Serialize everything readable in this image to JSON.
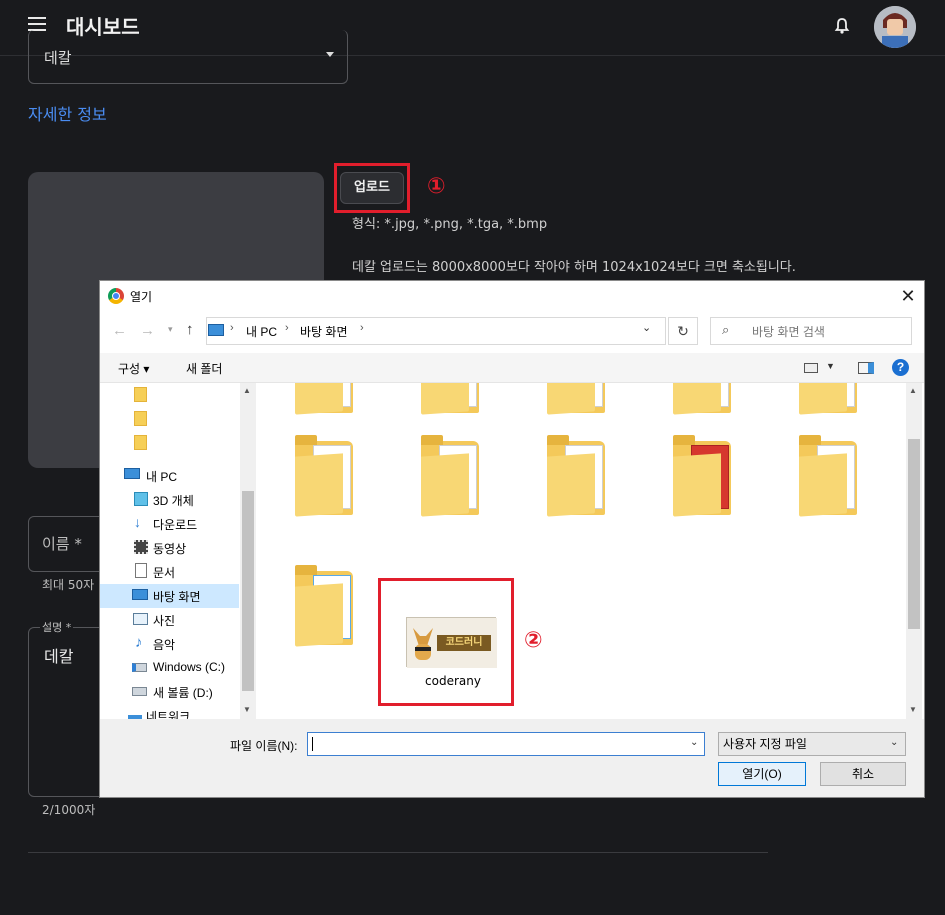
{
  "app": {
    "title": "대시보드"
  },
  "page": {
    "select_value": "데칼",
    "details_link": "자세한 정보",
    "upload_button": "업로드",
    "marker1": "①",
    "formats": "형식: *.jpg, *.png, *.tga, *.bmp",
    "decal_note": "데칼 업로드는 8000x8000보다 작아야 하며 1024x1024보다 크면 축소됩니다.",
    "name_label": "이름 *",
    "name_hint": "최대 50자",
    "desc_label": "설명 *",
    "desc_value": "데칼",
    "desc_count": "2/1000자"
  },
  "dialog": {
    "title": "열기",
    "close": "✕",
    "breadcrumb": [
      "내 PC",
      "바탕 화면"
    ],
    "search_placeholder": "바탕 화면 검색",
    "organize": "구성 ▾",
    "new_folder": "새 폴더",
    "help": "?",
    "tree": [
      {
        "label": "내 PC",
        "icon": "computer-icon"
      },
      {
        "label": "3D 개체",
        "icon": "cube-icon"
      },
      {
        "label": "다운로드",
        "icon": "download-icon"
      },
      {
        "label": "동영상",
        "icon": "video-icon"
      },
      {
        "label": "문서",
        "icon": "document-icon"
      },
      {
        "label": "바탕 화면",
        "icon": "desktop-icon",
        "selected": true
      },
      {
        "label": "사진",
        "icon": "picture-icon"
      },
      {
        "label": "음악",
        "icon": "music-icon"
      },
      {
        "label": "Windows (C:)",
        "icon": "drive-icon"
      },
      {
        "label": "새 볼륨 (D:)",
        "icon": "drive-icon"
      },
      {
        "label": "네트워크",
        "icon": "network-icon"
      }
    ],
    "file_name": "coderany",
    "thumb_text": "코드러니",
    "marker2": "②",
    "filename_label": "파일 이름(N):",
    "filename_value": "",
    "filetype": "사용자 지정 파일",
    "open_button": "열기(O)",
    "cancel_button": "취소"
  },
  "colors": {
    "accent": "#4a8cf0",
    "highlight": "#e11e2c",
    "background": "#191a1d"
  }
}
